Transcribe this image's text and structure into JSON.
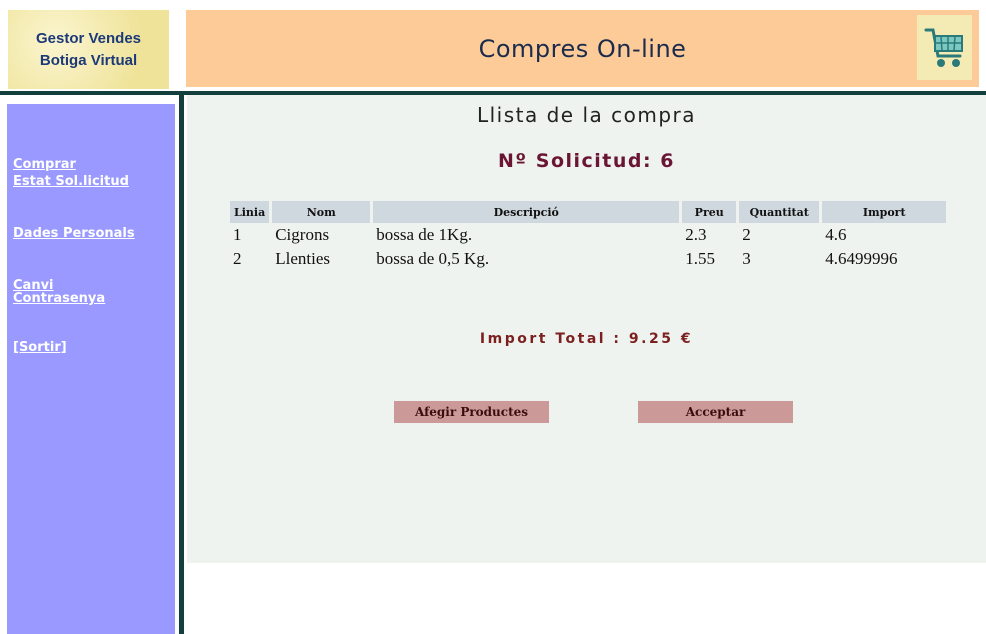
{
  "logo": {
    "line1": "Gestor Vendes",
    "line2": "Botiga Virtual"
  },
  "header": {
    "title": "Compres On-line",
    "cart_icon": "shopping-cart-icon"
  },
  "sidebar": {
    "links": [
      {
        "label": "Comprar"
      },
      {
        "label": "Estat Sol.licitud"
      },
      {
        "label": "Dades Personals"
      },
      {
        "label": "Canvi"
      },
      {
        "label": "Contrasenya"
      },
      {
        "label": "[Sortir]"
      }
    ]
  },
  "main": {
    "title": "Llista de la compra",
    "request_number": "Nº Solicitud: 6",
    "table": {
      "headers": [
        "Linia",
        "Nom",
        "Descripció",
        "Preu",
        "Quantitat",
        "Import"
      ],
      "rows": [
        [
          "1",
          "Cigrons",
          "bossa de 1Kg.",
          "2.3",
          "2",
          "4.6"
        ],
        [
          "2",
          "Llenties",
          "bossa de 0,5 Kg.",
          "1.55",
          "3",
          "4.6499996"
        ]
      ]
    },
    "total": "Import Total :  9.25  €",
    "buttons": {
      "add": "Afegir Productes",
      "accept": "Acceptar"
    }
  },
  "colors": {
    "header_bg": "#fdcb98",
    "sidebar_bg": "#9999ff",
    "divider": "#13403d",
    "main_bg": "#eff3ef",
    "button_bg": "#cc9999",
    "accent_text": "#6b1534"
  }
}
